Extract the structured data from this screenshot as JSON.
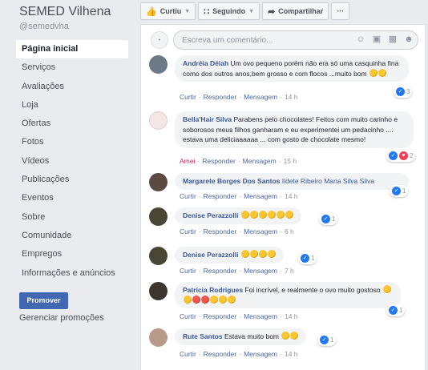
{
  "page": {
    "name": "SEMED Vilhena",
    "handle": "@semedvha"
  },
  "nav": [
    {
      "label": "Página inicial",
      "active": true
    },
    {
      "label": "Serviços"
    },
    {
      "label": "Avaliações"
    },
    {
      "label": "Loja"
    },
    {
      "label": "Ofertas"
    },
    {
      "label": "Fotos"
    },
    {
      "label": "Vídeos"
    },
    {
      "label": "Publicações"
    },
    {
      "label": "Eventos"
    },
    {
      "label": "Sobre"
    },
    {
      "label": "Comunidade"
    },
    {
      "label": "Empregos"
    },
    {
      "label": "Informações e anúncios"
    }
  ],
  "promote_button": "Promover",
  "manage_promotions": "Gerenciar promoções",
  "toolbar": {
    "like_label": "Curtiu",
    "follow_label": "Seguindo",
    "share_label": "Compartilhar",
    "more_label": "···"
  },
  "composer": {
    "placeholder": "Escreva um comentário..."
  },
  "actions": {
    "like": "Curtir",
    "love": "Amei",
    "reply": "Responder",
    "message": "Mensagem",
    "dot": "·"
  },
  "comments": [
    {
      "author": "Andréia Déiah",
      "text": "Um ovo pequeno porém não era só uma casquinha fina como dos outros anos,bem grosso e com flocos ...muito bom",
      "emojis": 2,
      "time": "14 h",
      "reactions": "3",
      "avatar_color": "#6b7a86"
    },
    {
      "author": "Bella'Hair Silva",
      "text": "Parabens pelo chocolates! Feitos com muito carinho e soborosos meus filhos ganharam e eu experimentei um pedacinho .... estava uma deliciaaaaaa ... com gosto de chocolate mesmo!",
      "emojis": 0,
      "time": "15 h",
      "reactions": "2",
      "avatar_color": "#f4e6e4"
    },
    {
      "author": "Margarete Borges Dos Santos",
      "mention": "Ildete Ribeiro Maria Silva Silva",
      "time": "14 h",
      "reactions": "1",
      "avatar_color": "#5a4a42"
    },
    {
      "author": "Denise Perazzolli",
      "emojis": 6,
      "time": "6 h",
      "reactions": "1",
      "avatar_color": "#4a4636"
    },
    {
      "author": "Denise Perazzolli",
      "emojis": 4,
      "time": "7 h",
      "reactions": "1",
      "avatar_color": "#4a4636"
    },
    {
      "author": "Patrícia Rodrigues",
      "text": "Foi incrível, e realmente o ovo muito gostoso",
      "emojis": 7,
      "time": "14 h",
      "reactions": "1",
      "avatar_color": "#3d3530"
    },
    {
      "author": "Rute Santos",
      "text": "Estava muito bom",
      "emojis": 2,
      "time": "14 h",
      "reactions": "1",
      "avatar_color": "#b89a8a"
    }
  ]
}
